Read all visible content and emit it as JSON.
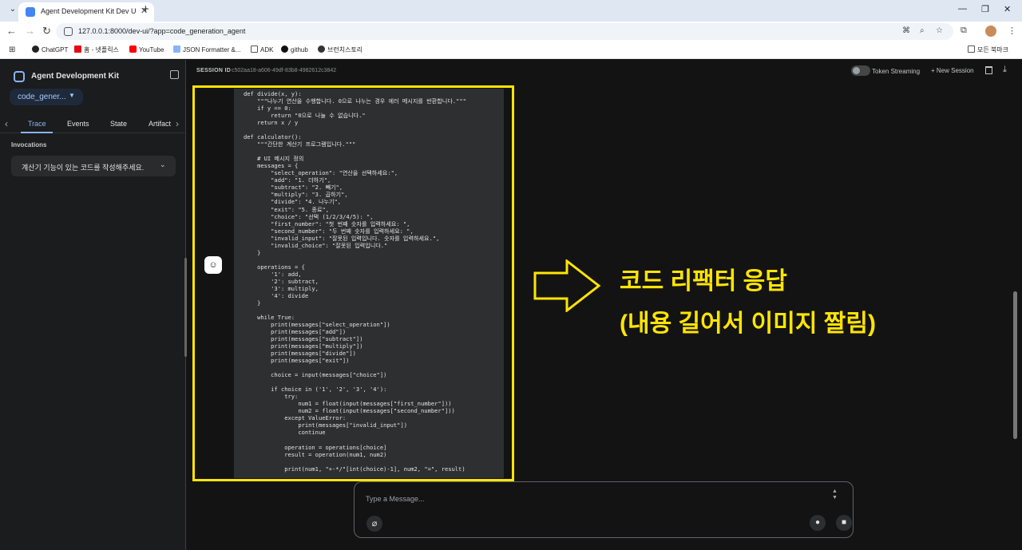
{
  "browser": {
    "tab_title": "Agent Development Kit Dev UI",
    "url": "127.0.0.1:8000/dev-ui/?app=code_generation_agent",
    "bookmarks": [
      "ChatGPT",
      "홈 - 넷플릭스",
      "YouTube",
      "JSON Formatter &...",
      "ADK",
      "github",
      "브런치스토리"
    ],
    "all_bookmarks": "모든 북마크"
  },
  "sidebar": {
    "app_title": "Agent Development Kit",
    "agent_name": "code_gener...",
    "tabs": [
      "Trace",
      "Events",
      "State",
      "Artifact"
    ],
    "invocations_label": "Invocations",
    "invocation_item": "계산기 기능이 있는 코드를 작성해주세요."
  },
  "session": {
    "label": "SESSION ID",
    "id": "c502aa18-a606-49df-83b8-4982612c3842",
    "token_streaming": "Token Streaming",
    "new_session": "New Session"
  },
  "chat": {
    "code": "def divide(x, y):\n    \"\"\"나누기 연산을 수행합니다. 0으로 나누는 경우 에러 메시지를 반환합니다.\"\"\"\n    if y == 0:\n        return \"0으로 나눌 수 없습니다.\"\n    return x / y\n\ndef calculator():\n    \"\"\"간단한 계산기 프로그램입니다.\"\"\"\n\n    # UI 메시지 정의\n    messages = {\n        \"select_operation\": \"연산을 선택하세요:\",\n        \"add\": \"1. 더하기\",\n        \"subtract\": \"2. 빼기\",\n        \"multiply\": \"3. 곱하기\",\n        \"divide\": \"4. 나누기\",\n        \"exit\": \"5. 종료\",\n        \"choice\": \"선택 (1/2/3/4/5): \",\n        \"first_number\": \"첫 번째 숫자를 입력하세요: \",\n        \"second_number\": \"두 번째 숫자를 입력하세요: \",\n        \"invalid_input\": \"잘못된 입력입니다. 숫자를 입력하세요.\",\n        \"invalid_choice\": \"잘못된 입력입니다.\"\n    }\n\n    operations = {\n        '1': add,\n        '2': subtract,\n        '3': multiply,\n        '4': divide\n    }\n\n    while True:\n        print(messages[\"select_operation\"])\n        print(messages[\"add\"])\n        print(messages[\"subtract\"])\n        print(messages[\"multiply\"])\n        print(messages[\"divide\"])\n        print(messages[\"exit\"])\n\n        choice = input(messages[\"choice\"])\n\n        if choice in ('1', '2', '3', '4'):\n            try:\n                num1 = float(input(messages[\"first_number\"]))\n                num2 = float(input(messages[\"second_number\"]))\n            except ValueError:\n                print(messages[\"invalid_input\"])\n                continue\n\n            operation = operations[choice]\n            result = operation(num1, num2)\n\n            print(num1, \"+-*/\"[int(choice)-1], num2, \"=\", result)",
    "annotation_line1": "코드 리팩터 응답",
    "annotation_line2": "(내용 길어서 이미지 짤림)",
    "highlight_color": "#ffe500"
  },
  "input": {
    "placeholder": "Type a Message..."
  },
  "colors": {
    "accent": "#8ab4f8",
    "background": "#131314",
    "annotation": "#ffe500"
  }
}
